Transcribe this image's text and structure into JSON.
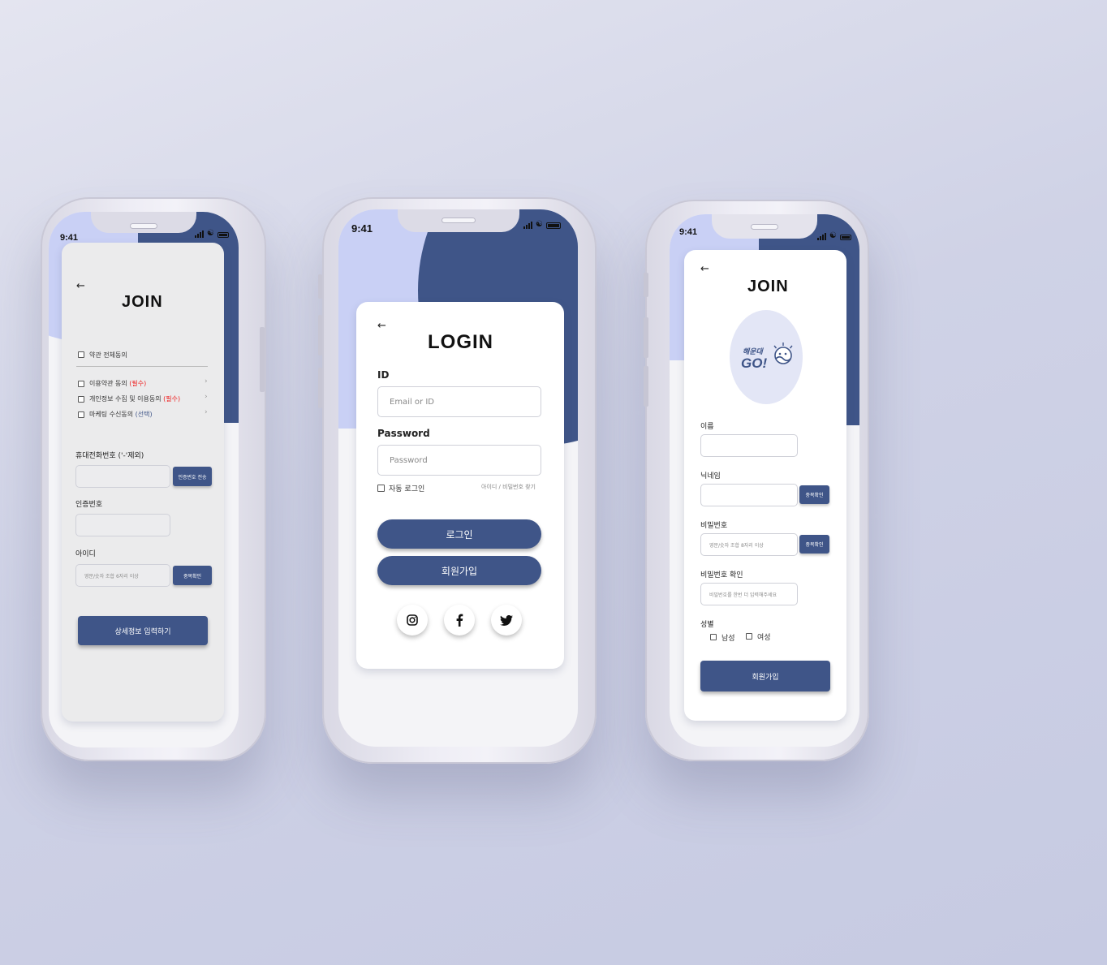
{
  "status": {
    "time": "9:41"
  },
  "left_phone": {
    "title": "JOIN",
    "agree_all": "약관 전체동의",
    "terms": [
      {
        "text": "이용약관 동의",
        "tag": "(필수)",
        "tag_kind": "required"
      },
      {
        "text": "개인정보 수집 및 이용동의",
        "tag": "(필수)",
        "tag_kind": "required"
      },
      {
        "text": "마케팅 수신동의",
        "tag": "(선택)",
        "tag_kind": "optional"
      }
    ],
    "phone_label": "휴대전화번호 ('-'제외)",
    "send_code_button": "인증번호 전송",
    "code_label": "인증번호",
    "id_label": "아이디",
    "id_placeholder": "영문/숫자 조합 6자리 이상",
    "dup_check_button": "중복확인",
    "next_button": "상세정보 입력하기"
  },
  "center_phone": {
    "title": "LOGIN",
    "id_label": "ID",
    "id_placeholder": "Email or ID",
    "password_label": "Password",
    "password_placeholder": "Password",
    "auto_login": "자동 로그인",
    "find_links": "아이디 / 비밀번호 찾기",
    "login_button": "로그인",
    "signup_button": "회원가입",
    "social": [
      "instagram-icon",
      "facebook-icon",
      "twitter-icon"
    ]
  },
  "right_phone": {
    "title": "JOIN",
    "logo_text_top": "해운대",
    "logo_text_bottom": "GO!",
    "name_label": "이름",
    "nickname_label": "닉네임",
    "nickname_dup_button": "중복확인",
    "password_label": "비밀번호",
    "password_placeholder": "영문/숫자 조합 8자리 이상",
    "password_dup_button": "중복확인",
    "password_confirm_label": "비밀번호 확인",
    "password_confirm_placeholder": "비밀번호를 한번 더 입력해주세요",
    "gender_label": "성별",
    "male": "남성",
    "female": "여성",
    "signup_button": "회원가입"
  },
  "colors": {
    "navy": "#3f5588",
    "lavender": "#c9d0f5",
    "required": "#e22222"
  }
}
